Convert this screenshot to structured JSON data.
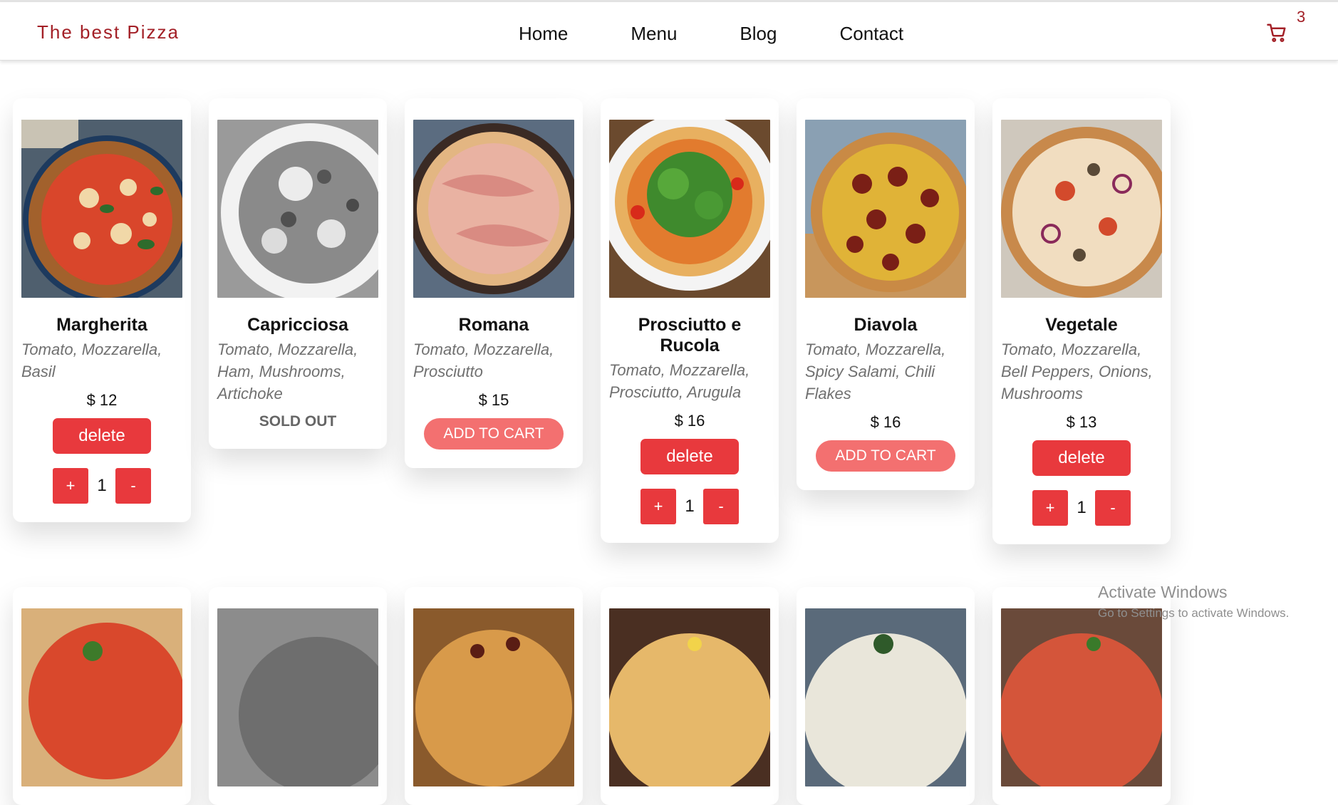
{
  "brand": "The best Pizza",
  "nav": [
    "Home",
    "Menu",
    "Blog",
    "Contact"
  ],
  "cart": {
    "icon": "cart-icon",
    "count": "3"
  },
  "colors": {
    "accent": "#e8393d",
    "brand": "#a32027",
    "add_button": "#f37070"
  },
  "products": [
    {
      "name": "Margherita",
      "description": "Tomato, Mozzarella, Basil",
      "price": "$ 12",
      "state": "in_cart",
      "quantity": "1",
      "delete_label": "delete"
    },
    {
      "name": "Capricciosa",
      "description": "Tomato, Mozzarella, Ham, Mushrooms, Artichoke",
      "state": "sold_out",
      "sold_out_label": "SOLD OUT"
    },
    {
      "name": "Romana",
      "description": "Tomato, Mozzarella, Prosciutto",
      "price": "$ 15",
      "state": "available",
      "add_label": "ADD TO CART"
    },
    {
      "name": "Prosciutto e Rucola",
      "description": "Tomato, Mozzarella, Prosciutto, Arugula",
      "price": "$ 16",
      "state": "in_cart",
      "quantity": "1",
      "delete_label": "delete"
    },
    {
      "name": "Diavola",
      "description": "Tomato, Mozzarella, Spicy Salami, Chili Flakes",
      "price": "$ 16",
      "state": "available",
      "add_label": "ADD TO CART"
    },
    {
      "name": "Vegetale",
      "description": "Tomato, Mozzarella, Bell Peppers, Onions, Mushrooms",
      "price": "$ 13",
      "state": "in_cart",
      "quantity": "1",
      "delete_label": "delete"
    }
  ],
  "qty_labels": {
    "plus": "+",
    "minus": "-"
  },
  "watermark": {
    "line1": "Activate Windows",
    "line2": "Go to Settings to activate Windows."
  }
}
